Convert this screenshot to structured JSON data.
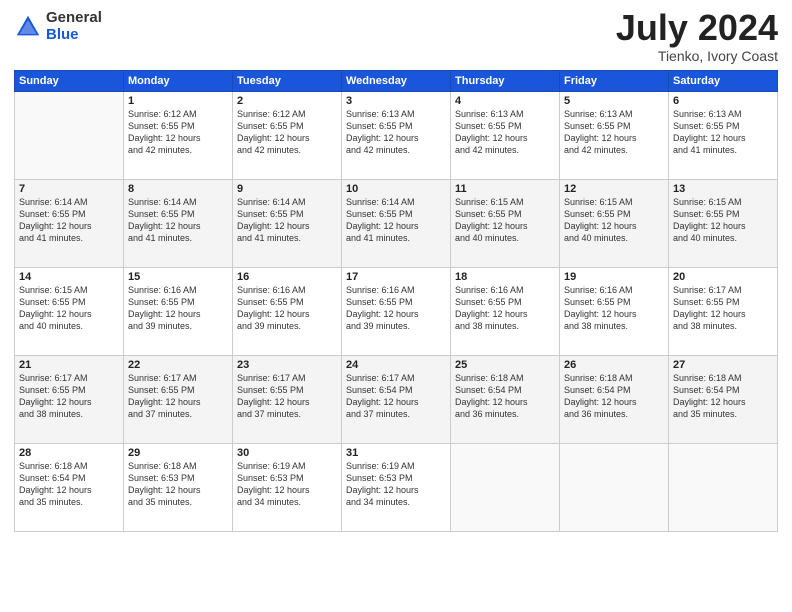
{
  "logo": {
    "general": "General",
    "blue": "Blue"
  },
  "title": {
    "month": "July 2024",
    "location": "Tienko, Ivory Coast"
  },
  "weekdays": [
    "Sunday",
    "Monday",
    "Tuesday",
    "Wednesday",
    "Thursday",
    "Friday",
    "Saturday"
  ],
  "weeks": [
    [
      {
        "day": "",
        "info": ""
      },
      {
        "day": "1",
        "info": "Sunrise: 6:12 AM\nSunset: 6:55 PM\nDaylight: 12 hours\nand 42 minutes."
      },
      {
        "day": "2",
        "info": "Sunrise: 6:12 AM\nSunset: 6:55 PM\nDaylight: 12 hours\nand 42 minutes."
      },
      {
        "day": "3",
        "info": "Sunrise: 6:13 AM\nSunset: 6:55 PM\nDaylight: 12 hours\nand 42 minutes."
      },
      {
        "day": "4",
        "info": "Sunrise: 6:13 AM\nSunset: 6:55 PM\nDaylight: 12 hours\nand 42 minutes."
      },
      {
        "day": "5",
        "info": "Sunrise: 6:13 AM\nSunset: 6:55 PM\nDaylight: 12 hours\nand 42 minutes."
      },
      {
        "day": "6",
        "info": "Sunrise: 6:13 AM\nSunset: 6:55 PM\nDaylight: 12 hours\nand 41 minutes."
      }
    ],
    [
      {
        "day": "7",
        "info": "Sunrise: 6:14 AM\nSunset: 6:55 PM\nDaylight: 12 hours\nand 41 minutes."
      },
      {
        "day": "8",
        "info": "Sunrise: 6:14 AM\nSunset: 6:55 PM\nDaylight: 12 hours\nand 41 minutes."
      },
      {
        "day": "9",
        "info": "Sunrise: 6:14 AM\nSunset: 6:55 PM\nDaylight: 12 hours\nand 41 minutes."
      },
      {
        "day": "10",
        "info": "Sunrise: 6:14 AM\nSunset: 6:55 PM\nDaylight: 12 hours\nand 41 minutes."
      },
      {
        "day": "11",
        "info": "Sunrise: 6:15 AM\nSunset: 6:55 PM\nDaylight: 12 hours\nand 40 minutes."
      },
      {
        "day": "12",
        "info": "Sunrise: 6:15 AM\nSunset: 6:55 PM\nDaylight: 12 hours\nand 40 minutes."
      },
      {
        "day": "13",
        "info": "Sunrise: 6:15 AM\nSunset: 6:55 PM\nDaylight: 12 hours\nand 40 minutes."
      }
    ],
    [
      {
        "day": "14",
        "info": "Sunrise: 6:15 AM\nSunset: 6:55 PM\nDaylight: 12 hours\nand 40 minutes."
      },
      {
        "day": "15",
        "info": "Sunrise: 6:16 AM\nSunset: 6:55 PM\nDaylight: 12 hours\nand 39 minutes."
      },
      {
        "day": "16",
        "info": "Sunrise: 6:16 AM\nSunset: 6:55 PM\nDaylight: 12 hours\nand 39 minutes."
      },
      {
        "day": "17",
        "info": "Sunrise: 6:16 AM\nSunset: 6:55 PM\nDaylight: 12 hours\nand 39 minutes."
      },
      {
        "day": "18",
        "info": "Sunrise: 6:16 AM\nSunset: 6:55 PM\nDaylight: 12 hours\nand 38 minutes."
      },
      {
        "day": "19",
        "info": "Sunrise: 6:16 AM\nSunset: 6:55 PM\nDaylight: 12 hours\nand 38 minutes."
      },
      {
        "day": "20",
        "info": "Sunrise: 6:17 AM\nSunset: 6:55 PM\nDaylight: 12 hours\nand 38 minutes."
      }
    ],
    [
      {
        "day": "21",
        "info": "Sunrise: 6:17 AM\nSunset: 6:55 PM\nDaylight: 12 hours\nand 38 minutes."
      },
      {
        "day": "22",
        "info": "Sunrise: 6:17 AM\nSunset: 6:55 PM\nDaylight: 12 hours\nand 37 minutes."
      },
      {
        "day": "23",
        "info": "Sunrise: 6:17 AM\nSunset: 6:55 PM\nDaylight: 12 hours\nand 37 minutes."
      },
      {
        "day": "24",
        "info": "Sunrise: 6:17 AM\nSunset: 6:54 PM\nDaylight: 12 hours\nand 37 minutes."
      },
      {
        "day": "25",
        "info": "Sunrise: 6:18 AM\nSunset: 6:54 PM\nDaylight: 12 hours\nand 36 minutes."
      },
      {
        "day": "26",
        "info": "Sunrise: 6:18 AM\nSunset: 6:54 PM\nDaylight: 12 hours\nand 36 minutes."
      },
      {
        "day": "27",
        "info": "Sunrise: 6:18 AM\nSunset: 6:54 PM\nDaylight: 12 hours\nand 35 minutes."
      }
    ],
    [
      {
        "day": "28",
        "info": "Sunrise: 6:18 AM\nSunset: 6:54 PM\nDaylight: 12 hours\nand 35 minutes."
      },
      {
        "day": "29",
        "info": "Sunrise: 6:18 AM\nSunset: 6:53 PM\nDaylight: 12 hours\nand 35 minutes."
      },
      {
        "day": "30",
        "info": "Sunrise: 6:19 AM\nSunset: 6:53 PM\nDaylight: 12 hours\nand 34 minutes."
      },
      {
        "day": "31",
        "info": "Sunrise: 6:19 AM\nSunset: 6:53 PM\nDaylight: 12 hours\nand 34 minutes."
      },
      {
        "day": "",
        "info": ""
      },
      {
        "day": "",
        "info": ""
      },
      {
        "day": "",
        "info": ""
      }
    ]
  ]
}
